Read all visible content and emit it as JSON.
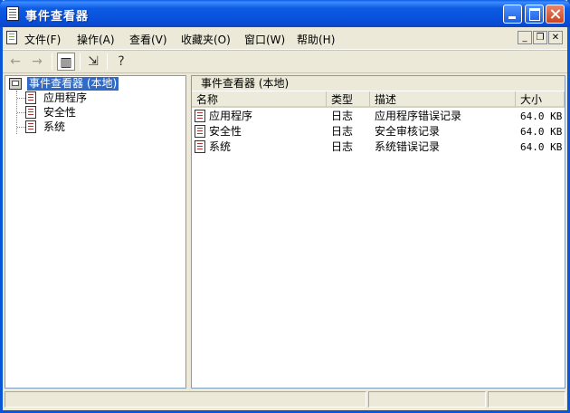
{
  "window": {
    "title": "事件查看器"
  },
  "menu": [
    {
      "label": "文件(F)"
    },
    {
      "label": "操作(A)"
    },
    {
      "label": "查看(V)"
    },
    {
      "label": "收藏夹(O)"
    },
    {
      "label": "窗口(W)"
    },
    {
      "label": "帮助(H)"
    }
  ],
  "toolbar": {
    "back_icon": "arrow-left-icon",
    "forward_icon": "arrow-right-icon",
    "show_hide_tree_icon": "console-tree-icon",
    "export_icon": "export-list-icon",
    "help_icon": "help-icon"
  },
  "tree": {
    "root": "事件查看器 (本地)",
    "items": [
      "应用程序",
      "安全性",
      "系统"
    ]
  },
  "right_pane": {
    "header": "事件查看器 (本地)",
    "columns": [
      "名称",
      "类型",
      "描述",
      "大小"
    ],
    "rows": [
      {
        "name": "应用程序",
        "type": "日志",
        "desc": "应用程序错误记录",
        "size": "64.0 KB"
      },
      {
        "name": "安全性",
        "type": "日志",
        "desc": "安全审核记录",
        "size": "64.0 KB"
      },
      {
        "name": "系统",
        "type": "日志",
        "desc": "系统错误记录",
        "size": "64.0 KB"
      }
    ]
  },
  "colors": {
    "title_bar": "#0a5de6",
    "selection": "#316ac5",
    "chrome": "#ece9d8"
  }
}
